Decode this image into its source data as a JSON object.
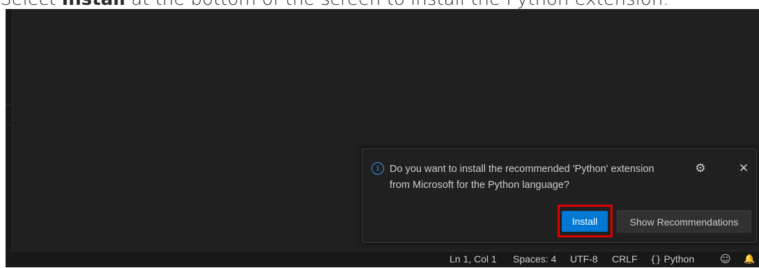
{
  "caption": {
    "prefix": "Select ",
    "bold": "Install",
    "suffix": " at the bottom of the screen to install the Python extension."
  },
  "notification": {
    "info_icon_glyph": "i",
    "message_line1": "Do you want to install the recommended 'Python' extension",
    "message_line2": "from Microsoft for the Python language?",
    "gear_icon_glyph": "⚙",
    "close_icon_glyph": "✕",
    "install_label": "Install",
    "show_recommendations_label": "Show Recommendations"
  },
  "statusbar": {
    "position": "Ln 1, Col 1",
    "spaces": "Spaces: 4",
    "encoding": "UTF-8",
    "eol": "CRLF",
    "language_braces": "{}",
    "language": "Python",
    "copilot_icon_glyph": "☺",
    "bell_icon_glyph": "🔔"
  },
  "colors": {
    "editor_bg": "#1f1f1f",
    "statusbar_bg": "#181818",
    "accent_blue": "#0078d4",
    "info_blue": "#3794ff",
    "highlight_red": "#e00000"
  }
}
